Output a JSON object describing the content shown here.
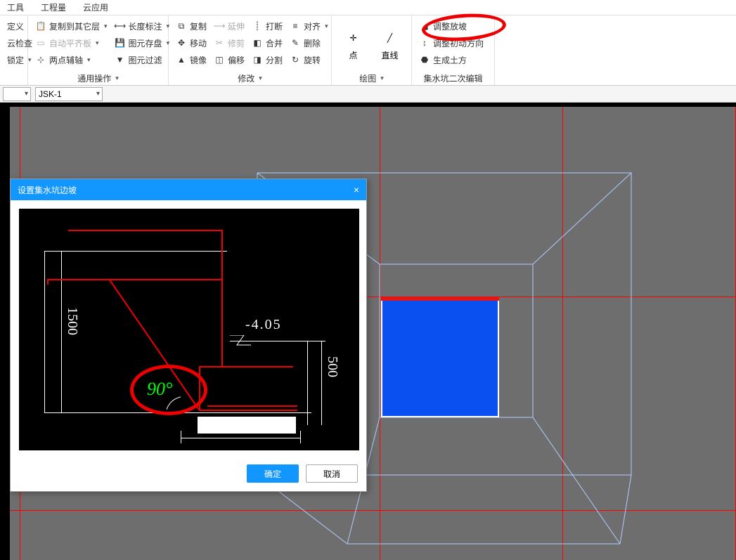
{
  "menu": {
    "tools": "工具",
    "measure": "工程量",
    "cloud": "云应用"
  },
  "ribbon": {
    "g1": {
      "b1": "定义",
      "b2": "云检查",
      "b3": "锁定"
    },
    "g2": {
      "b1": "复制到其它层",
      "b2": "自动平齐板",
      "b3": "两点辅轴",
      "b4": "长度标注",
      "b5": "图元存盘",
      "b6": "图元过滤",
      "label": "通用操作"
    },
    "g3": {
      "b1": "复制",
      "b2": "移动",
      "b3": "镜像",
      "b4": "延伸",
      "b5": "修剪",
      "b6": "偏移",
      "b7": "打断",
      "b8": "合并",
      "b9": "分割",
      "b10": "对齐",
      "b11": "删除",
      "b12": "旋转",
      "label": "修改"
    },
    "g4": {
      "b1": "点",
      "b2": "直线",
      "label": "绘图"
    },
    "g5": {
      "b1": "调整放坡",
      "b2": "调整初动方向",
      "b3": "生成土方",
      "label": "集水坑二次编辑"
    },
    "chev": "▾"
  },
  "combo": {
    "c1": "",
    "c2": "JSK-1"
  },
  "dialog": {
    "title": "设置集水坑边坡",
    "ok": "确定",
    "cancel": "取消",
    "dim1": "1500",
    "dim2": "500",
    "elev": "-4.05",
    "angle": "90°"
  }
}
